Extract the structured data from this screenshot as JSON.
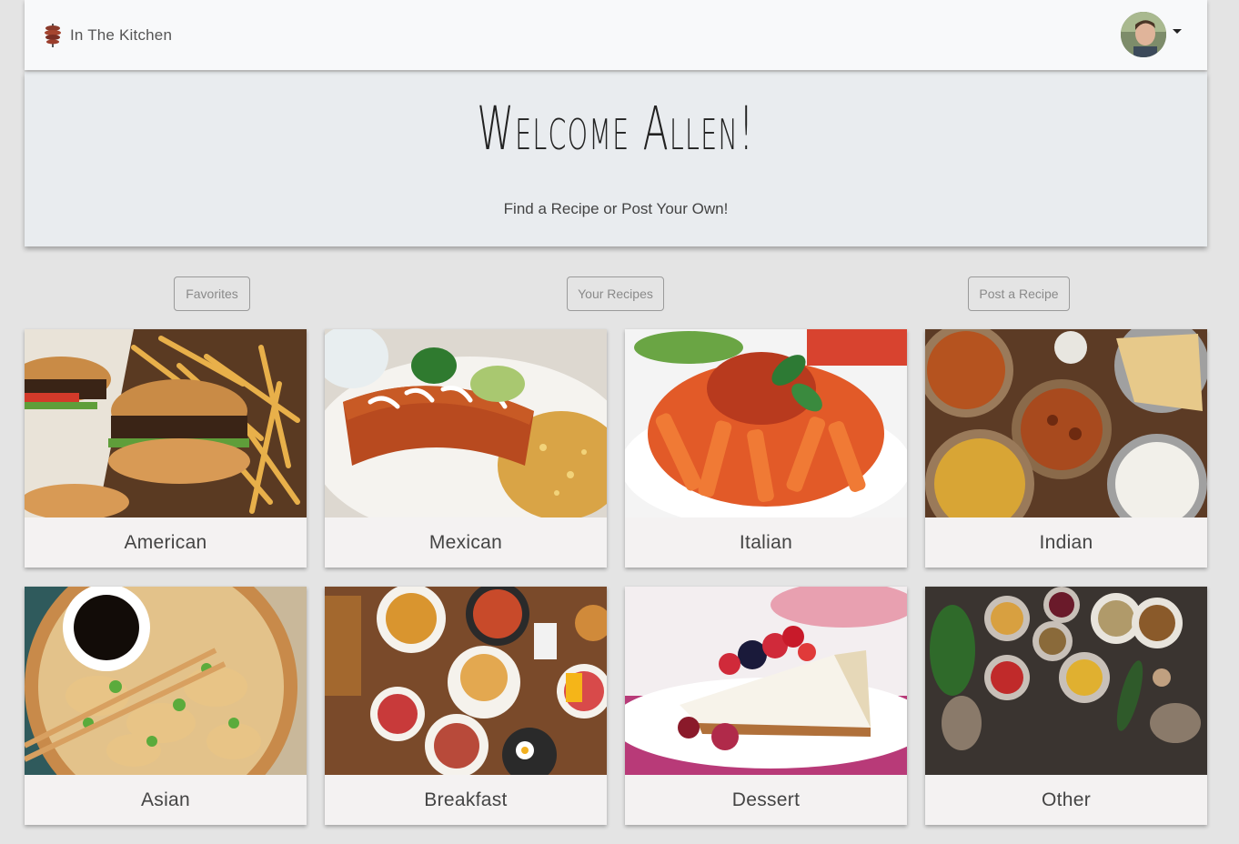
{
  "navbar": {
    "brand": "In The Kitchen",
    "brand_icon": "kebab-icon",
    "avatar_icon": "user-avatar"
  },
  "hero": {
    "title": "Welcome Allen!",
    "subtitle": "Find a Recipe or Post Your Own!"
  },
  "actions": {
    "favorites": "Favorites",
    "your_recipes": "Your Recipes",
    "post_recipe": "Post a Recipe"
  },
  "categories": [
    {
      "label": "American",
      "image": "burgers-and-fries"
    },
    {
      "label": "Mexican",
      "image": "enchiladas-with-rice"
    },
    {
      "label": "Italian",
      "image": "penne-pasta"
    },
    {
      "label": "Indian",
      "image": "curry-dishes-and-naan"
    },
    {
      "label": "Asian",
      "image": "dumplings-with-soy-sauce"
    },
    {
      "label": "Breakfast",
      "image": "breakfast-spread"
    },
    {
      "label": "Dessert",
      "image": "berry-cheesecake"
    },
    {
      "label": "Other",
      "image": "spice-bowls"
    }
  ]
}
